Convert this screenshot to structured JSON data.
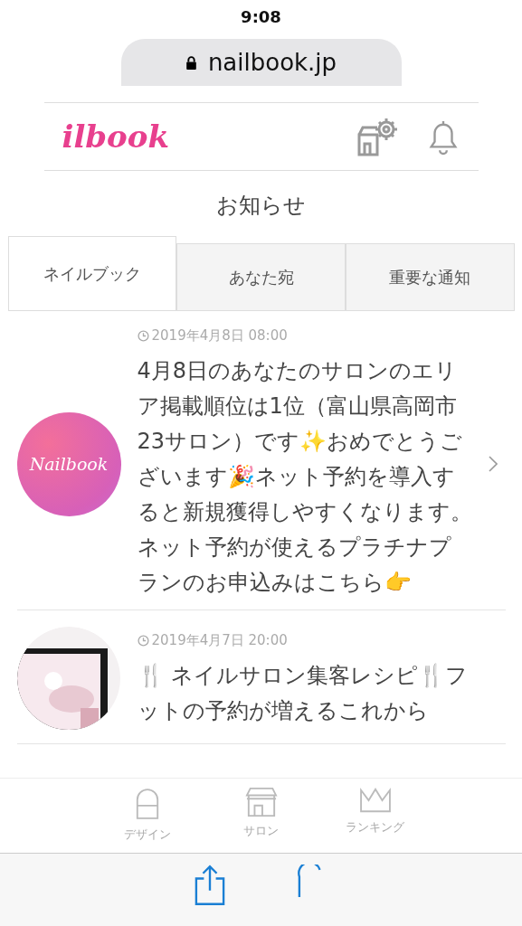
{
  "status_bar": {
    "time": "9:08"
  },
  "address_bar": {
    "url": "nailbook.jp"
  },
  "header": {
    "logo": "ilbook"
  },
  "page_title": "お知らせ",
  "tabs": [
    {
      "label": "ネイルブック",
      "selected": true
    },
    {
      "label": "あなた宛",
      "selected": false
    },
    {
      "label": "重要な通知",
      "selected": false
    }
  ],
  "notifications": [
    {
      "date": "2019年4月8日 08:00",
      "avatar": {
        "kind": "logo",
        "text": "Nailbook"
      },
      "message": "4月8日のあなたのサロンのエリア掲載順位は1位（富山県高岡市23サロン）です✨おめでとうございます🎉ネット予約を導入すると新規獲得しやすくなります。ネット予約が使えるプラチナプランのお申込みはこちら👉"
    },
    {
      "date": "2019年4月7日 20:00",
      "message": "🍴 ネイルサロン集客レシピ🍴フットの予約が増えるこれから"
    }
  ],
  "bottom_nav": [
    {
      "label": "デザイン",
      "kind": "nail"
    },
    {
      "label": "サロン",
      "kind": "shop"
    },
    {
      "label": "ランキング",
      "kind": "crown"
    }
  ]
}
